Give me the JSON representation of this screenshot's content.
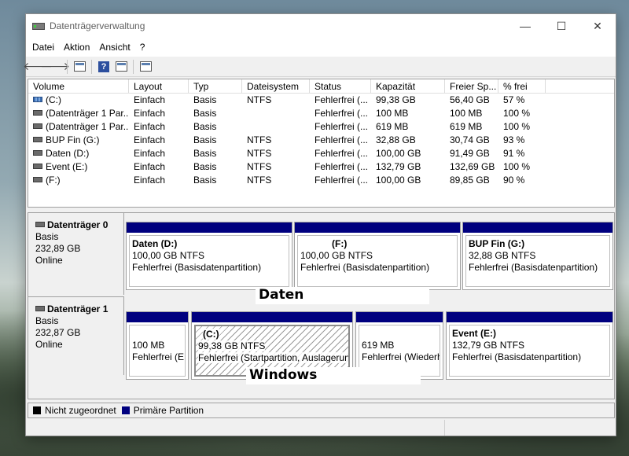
{
  "window": {
    "title": "Datenträgerverwaltung",
    "min": "—",
    "max": "☐",
    "close": "✕"
  },
  "menu": [
    "Datei",
    "Aktion",
    "Ansicht",
    "?"
  ],
  "toolbar": {
    "back": "🡐",
    "forward": "🡒",
    "help": "?"
  },
  "columns": [
    "Volume",
    "Layout",
    "Typ",
    "Dateisystem",
    "Status",
    "Kapazität",
    "Freier Sp...",
    "% frei"
  ],
  "volumes": [
    {
      "name": "(C:)",
      "layout": "Einfach",
      "type": "Basis",
      "fs": "NTFS",
      "status": "Fehlerfrei (...",
      "capacity": "99,38 GB",
      "free": "56,40 GB",
      "pct": "57 %",
      "icon": "system-drive-icon"
    },
    {
      "name": "(Datenträger 1 Par...",
      "layout": "Einfach",
      "type": "Basis",
      "fs": "",
      "status": "Fehlerfrei (...",
      "capacity": "100 MB",
      "free": "100 MB",
      "pct": "100 %",
      "icon": "drive-icon"
    },
    {
      "name": "(Datenträger 1 Par...",
      "layout": "Einfach",
      "type": "Basis",
      "fs": "",
      "status": "Fehlerfrei (...",
      "capacity": "619 MB",
      "free": "619 MB",
      "pct": "100 %",
      "icon": "drive-icon"
    },
    {
      "name": "BUP Fin (G:)",
      "layout": "Einfach",
      "type": "Basis",
      "fs": "NTFS",
      "status": "Fehlerfrei (...",
      "capacity": "32,88 GB",
      "free": "30,74 GB",
      "pct": "93 %",
      "icon": "drive-icon"
    },
    {
      "name": "Daten (D:)",
      "layout": "Einfach",
      "type": "Basis",
      "fs": "NTFS",
      "status": "Fehlerfrei (...",
      "capacity": "100,00 GB",
      "free": "91,49 GB",
      "pct": "91 %",
      "icon": "drive-icon"
    },
    {
      "name": "Event (E:)",
      "layout": "Einfach",
      "type": "Basis",
      "fs": "NTFS",
      "status": "Fehlerfrei (...",
      "capacity": "132,79 GB",
      "free": "132,69 GB",
      "pct": "100 %",
      "icon": "drive-icon"
    },
    {
      "name": "(F:)",
      "layout": "Einfach",
      "type": "Basis",
      "fs": "NTFS",
      "status": "Fehlerfrei (...",
      "capacity": "100,00 GB",
      "free": "89,85 GB",
      "pct": "90 %",
      "icon": "drive-icon"
    }
  ],
  "disks": [
    {
      "name": "Datenträger 0",
      "type": "Basis",
      "size": "232,89 GB",
      "state": "Online",
      "partitions": [
        {
          "label": "Daten  (D:)",
          "size": "100,00 GB NTFS",
          "status": "Fehlerfrei (Basisdatenpartition)"
        },
        {
          "label": "(F:)",
          "size": "100,00 GB NTFS",
          "status": "Fehlerfrei (Basisdatenpartition)"
        },
        {
          "label": "BUP Fin  (G:)",
          "size": "32,88 GB NTFS",
          "status": "Fehlerfrei (Basisdatenpartition)"
        }
      ],
      "overlay": "Daten"
    },
    {
      "name": "Datenträger 1",
      "type": "Basis",
      "size": "232,87 GB",
      "state": "Online",
      "partitions": [
        {
          "label": "",
          "size": "100 MB",
          "status": "Fehlerfrei (EF"
        },
        {
          "label": "(C:)",
          "size": "99,38 GB NTFS",
          "status": "Fehlerfrei (Startpartition, Auslagerun"
        },
        {
          "label": "",
          "size": "619 MB",
          "status": "Fehlerfrei (Wiederh"
        },
        {
          "label": "Event  (E:)",
          "size": "132,79 GB NTFS",
          "status": "Fehlerfrei (Basisdatenpartition)"
        }
      ],
      "overlay": "Windows"
    }
  ],
  "legend": [
    {
      "label": "Nicht zugeordnet",
      "color": "#000000"
    },
    {
      "label": "Primäre Partition",
      "color": "#00007f"
    }
  ]
}
